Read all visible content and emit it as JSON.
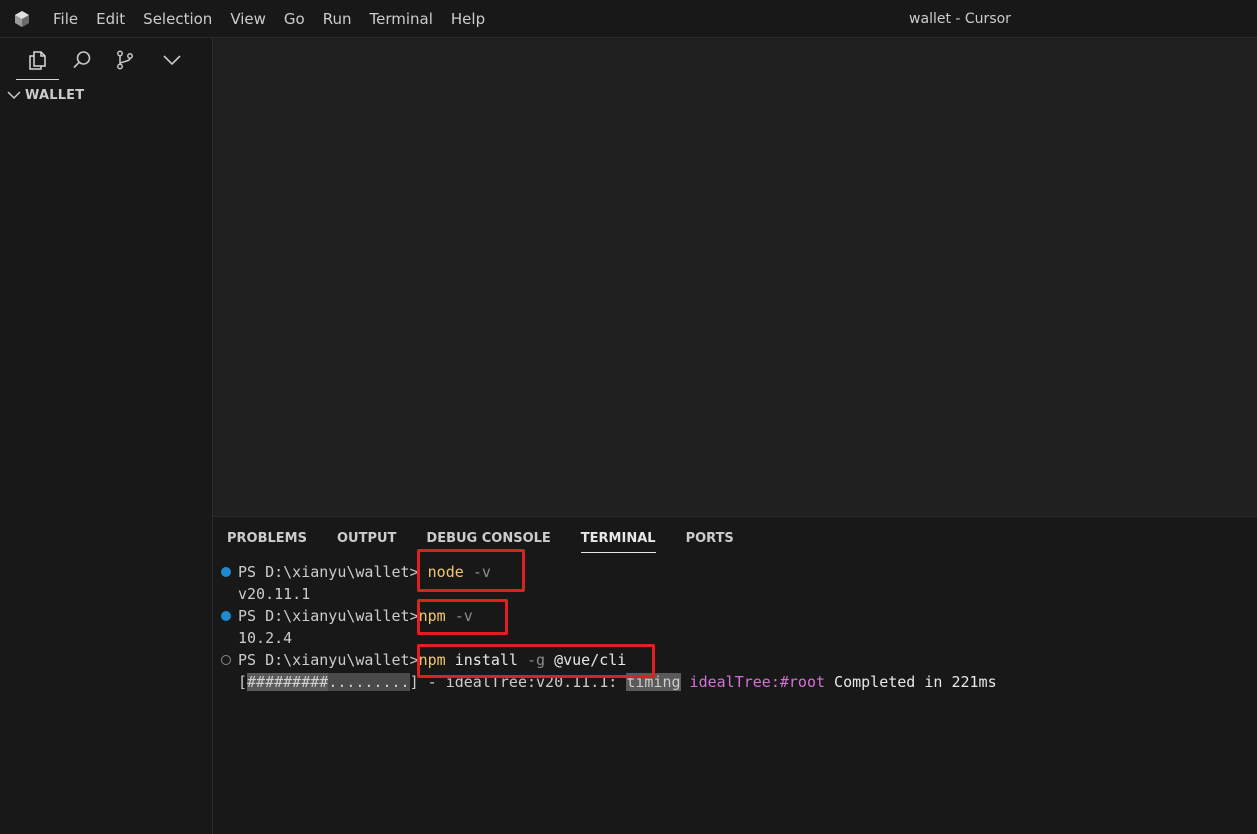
{
  "titlebar": {
    "app_icon": "cursor-cube-icon",
    "menu": [
      "File",
      "Edit",
      "Selection",
      "View",
      "Go",
      "Run",
      "Terminal",
      "Help"
    ],
    "window_title": "wallet - Cursor"
  },
  "sidebar": {
    "tabs": [
      "files-icon",
      "search-icon",
      "source-control-icon",
      "chevron-down-icon"
    ],
    "explorer_title": "WALLET"
  },
  "panel": {
    "tabs": [
      "PROBLEMS",
      "OUTPUT",
      "DEBUG CONSOLE",
      "TERMINAL",
      "PORTS"
    ],
    "active_tab": "TERMINAL"
  },
  "terminal": {
    "lines": [
      {
        "prompt": "PS D:\\xianyu\\wallet>",
        "cmd": "node",
        "args": "-v",
        "status": "success"
      },
      {
        "output": "v20.11.1"
      },
      {
        "prompt": "PS D:\\xianyu\\wallet>",
        "cmd": "npm",
        "args": "-v",
        "status": "success"
      },
      {
        "output": "10.2.4"
      },
      {
        "prompt": "PS D:\\xianyu\\wallet>",
        "cmd": "npm",
        "args": "install",
        "flag": "-g",
        "pkg": "@vue/cli",
        "status": "running"
      },
      {
        "progress_open": "[",
        "progress_filled": "#########",
        "progress_empty": ".........",
        "progress_close": "]",
        "progress_text": " - idealTree:v20.11.1: ",
        "timing_label": "timing",
        "tree_label": " idealTree:#root",
        "completed": " Completed in 221ms"
      }
    ]
  },
  "colors": {
    "highlight_box": "#e02020",
    "command": "#dcdcaa",
    "success_dot": "#1f8ad2"
  }
}
